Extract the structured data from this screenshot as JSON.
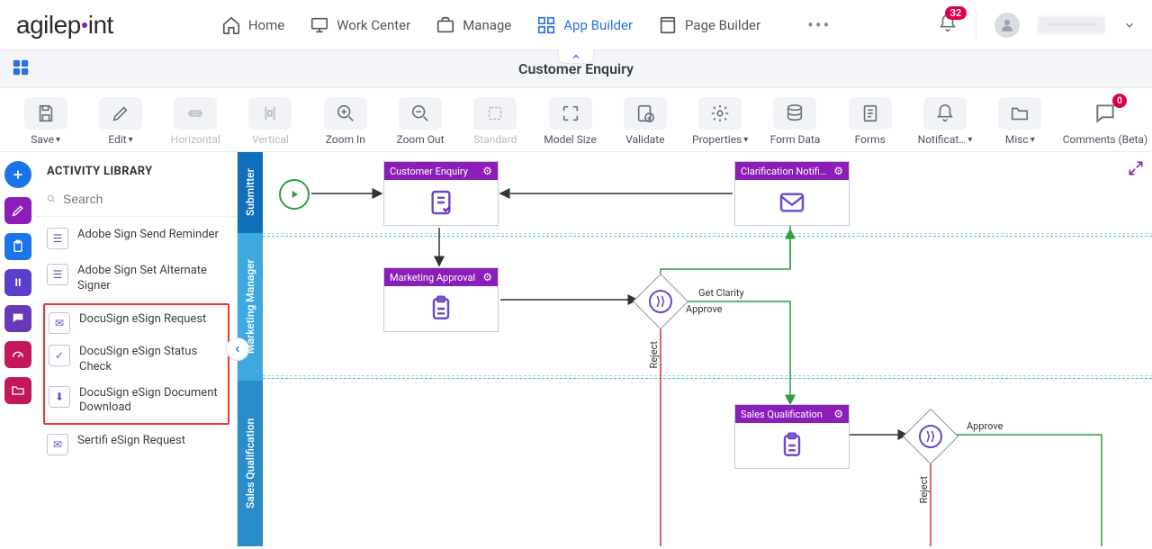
{
  "brand": "agilepoint",
  "nav": {
    "items": [
      {
        "label": "Home",
        "icon": "home"
      },
      {
        "label": "Work Center",
        "icon": "monitor"
      },
      {
        "label": "Manage",
        "icon": "briefcase"
      },
      {
        "label": "App Builder",
        "icon": "grid",
        "active": true
      },
      {
        "label": "Page Builder",
        "icon": "page"
      }
    ],
    "notifications_count": "32",
    "username_masked": "—————"
  },
  "page_title": "Customer Enquiry",
  "toolbar": [
    {
      "label": "Save",
      "icon": "save",
      "chev": true,
      "boxed": true
    },
    {
      "label": "Edit",
      "icon": "edit",
      "chev": true,
      "boxed": true
    },
    {
      "label": "Horizontal",
      "icon": "alignh",
      "muted": true,
      "boxed": true
    },
    {
      "label": "Vertical",
      "icon": "alignv",
      "muted": true,
      "boxed": true
    },
    {
      "label": "Zoom In",
      "icon": "zoomin",
      "boxed": true
    },
    {
      "label": "Zoom Out",
      "icon": "zoomout",
      "boxed": true
    },
    {
      "label": "Standard",
      "icon": "fit",
      "muted": true,
      "boxed": true
    },
    {
      "label": "Model Size",
      "icon": "modelsize",
      "boxed": true
    },
    {
      "label": "Validate",
      "icon": "validate",
      "boxed": true
    },
    {
      "label": "Properties",
      "icon": "props",
      "chev": true,
      "boxed": true
    },
    {
      "label": "Form Data",
      "icon": "formdata",
      "boxed": true
    },
    {
      "label": "Forms",
      "icon": "forms",
      "boxed": true
    },
    {
      "label": "Notificat…",
      "icon": "bell",
      "chev": true,
      "boxed": true
    },
    {
      "label": "Misc",
      "icon": "folder",
      "chev": true,
      "boxed": true
    }
  ],
  "comments": {
    "label": "Comments (Beta)",
    "count": "0"
  },
  "activity_library": {
    "title": "ACTIVITY LIBRARY",
    "search_placeholder": "Search",
    "items_top": [
      "Adobe Sign Send Reminder",
      "Adobe Sign Set Alternate Signer"
    ],
    "items_highlighted": [
      "DocuSign eSign Request",
      "DocuSign eSign Status Check",
      "DocuSign eSign Document Download"
    ],
    "items_bottom": [
      "Sertifi eSign Request"
    ]
  },
  "lanes": [
    "Submitter",
    "Marketing Manager",
    "Sales Qualification"
  ],
  "activities": {
    "customer_enquiry": "Customer Enquiry",
    "clarification": "Clarification Notifi…",
    "marketing_approval": "Marketing Approval",
    "sales_qualification": "Sales Qualification"
  },
  "edge_labels": {
    "get_clarity": "Get Clarity",
    "approve": "Approve",
    "reject": "Reject",
    "approve2": "Approve",
    "reject2": "Reject"
  }
}
